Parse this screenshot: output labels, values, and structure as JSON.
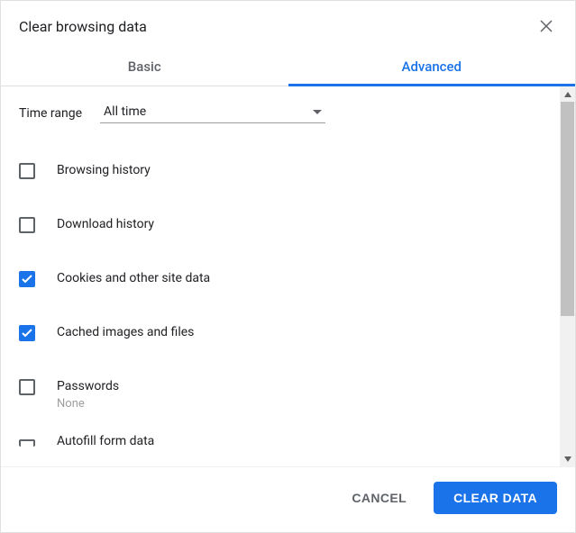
{
  "dialog": {
    "title": "Clear browsing data"
  },
  "tabs": {
    "basic": "Basic",
    "advanced": "Advanced"
  },
  "timeRange": {
    "label": "Time range",
    "value": "All time"
  },
  "options": [
    {
      "label": "Browsing history",
      "sub": "",
      "checked": false
    },
    {
      "label": "Download history",
      "sub": "",
      "checked": false
    },
    {
      "label": "Cookies and other site data",
      "sub": "",
      "checked": true
    },
    {
      "label": "Cached images and files",
      "sub": "",
      "checked": true
    },
    {
      "label": "Passwords",
      "sub": "None",
      "checked": false
    },
    {
      "label": "Autofill form data",
      "sub": "",
      "checked": false
    }
  ],
  "footer": {
    "cancel": "CANCEL",
    "clear": "CLEAR DATA"
  }
}
